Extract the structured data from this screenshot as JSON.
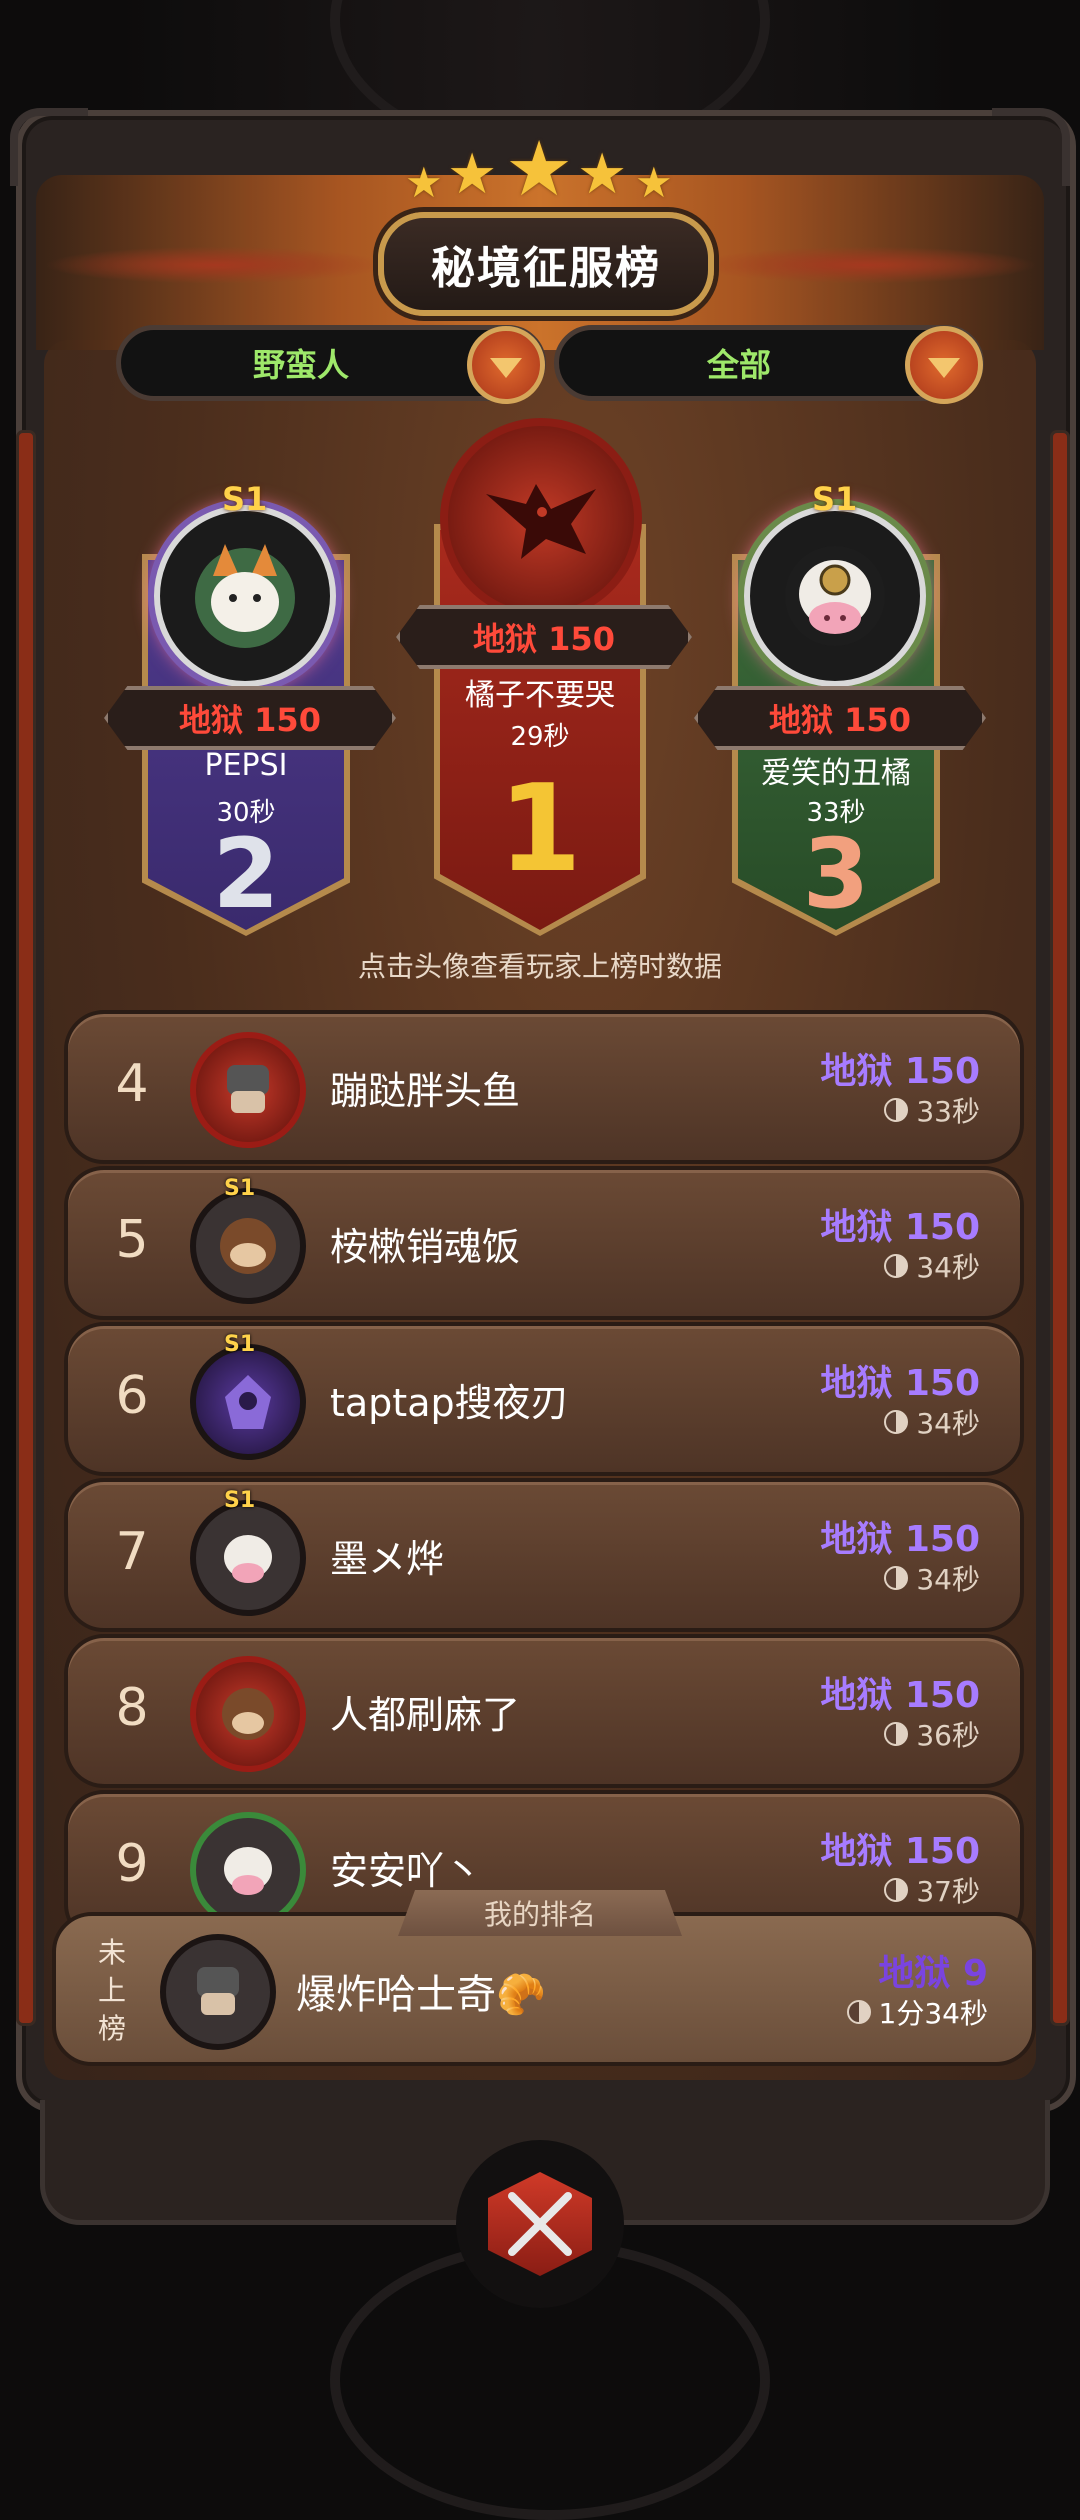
{
  "title": "秘境征服榜",
  "filters": {
    "class_label": "野蛮人",
    "scope_label": "全部"
  },
  "podium": {
    "first": {
      "rank": "1",
      "score": "地狱 150",
      "name": "橘子不要哭",
      "time": "29秒"
    },
    "second": {
      "rank": "2",
      "season": "S1",
      "score": "地狱 150",
      "name": "PEPSI",
      "time": "30秒"
    },
    "third": {
      "rank": "3",
      "season": "S1",
      "score": "地狱 150",
      "name": "爱笑的丑橘",
      "time": "33秒"
    }
  },
  "hint": "点击头像查看玩家上榜时数据",
  "list": [
    {
      "rank": "4",
      "name": "蹦跶胖头鱼",
      "score": "地狱 150",
      "time": "33秒",
      "season": ""
    },
    {
      "rank": "5",
      "name": "桉樕销魂饭",
      "score": "地狱 150",
      "time": "34秒",
      "season": "S1"
    },
    {
      "rank": "6",
      "name": "taptap搜夜刃",
      "score": "地狱 150",
      "time": "34秒",
      "season": "S1"
    },
    {
      "rank": "7",
      "name": "墨メ烨",
      "score": "地狱 150",
      "time": "34秒",
      "season": "S1"
    },
    {
      "rank": "8",
      "name": "人都刷麻了",
      "score": "地狱 150",
      "time": "36秒",
      "season": ""
    },
    {
      "rank": "9",
      "name": "安安吖丶",
      "score": "地狱 150",
      "time": "37秒",
      "season": ""
    }
  ],
  "my_rank": {
    "tab_label": "我的排名",
    "status": [
      "未",
      "上",
      "榜"
    ],
    "name": "爆炸哈士奇",
    "emoji": "🥐",
    "score": "地狱 9",
    "time": "1分34秒"
  },
  "colors": {
    "hell_score": "#a77cff",
    "first_score": "#ff4a3a",
    "filter_text": "#9ee86a"
  }
}
